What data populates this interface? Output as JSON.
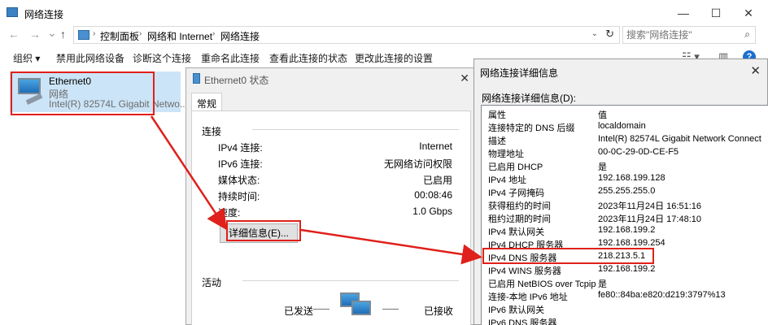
{
  "window": {
    "title": "网络连接",
    "minimize": "—",
    "maximize": "☐",
    "close": "✕"
  },
  "address": {
    "back": "←",
    "forward": "→",
    "recent": "⌄",
    "up": "↑",
    "crumbs": [
      "控制面板",
      "网络和 Internet",
      "网络连接"
    ],
    "separator": "›",
    "refresh": "↻",
    "search_placeholder": "搜索\"网络连接\""
  },
  "toolbar": {
    "organize": "组织 ▾",
    "items": [
      "禁用此网络设备",
      "诊断这个连接",
      "重命名此连接",
      "查看此连接的状态",
      "更改此连接的设置"
    ],
    "view_icon": "☷ ▾",
    "pane_icon": "▥",
    "help": "?"
  },
  "adapter": {
    "name": "Ethernet0",
    "network": "网络",
    "description": "Intel(R) 82574L Gigabit Netwo..."
  },
  "status_dialog": {
    "title": "Ethernet0 状态",
    "close": "✕",
    "tab": "常规",
    "connection_section": "连接",
    "rows": [
      {
        "label": "IPv4 连接:",
        "value": "Internet"
      },
      {
        "label": "IPv6 连接:",
        "value": "无网络访问权限"
      },
      {
        "label": "媒体状态:",
        "value": "已启用"
      },
      {
        "label": "持续时间:",
        "value": "00:08:46"
      },
      {
        "label": "速度:",
        "value": "1.0 Gbps"
      }
    ],
    "details_button": "详细信息(E)...",
    "activity_section": "活动",
    "sent": "已发送",
    "received": "已接收"
  },
  "details_dialog": {
    "title": "网络连接详细信息",
    "close": "✕",
    "list_label": "网络连接详细信息(D):",
    "header": {
      "property": "属性",
      "value": "值"
    },
    "rows": [
      {
        "property": "连接特定的 DNS 后缀",
        "value": "localdomain"
      },
      {
        "property": "描述",
        "value": "Intel(R) 82574L Gigabit Network Connect"
      },
      {
        "property": "物理地址",
        "value": "00-0C-29-0D-CE-F5"
      },
      {
        "property": "已启用 DHCP",
        "value": "是"
      },
      {
        "property": "IPv4 地址",
        "value": "192.168.199.128"
      },
      {
        "property": "IPv4 子网掩码",
        "value": "255.255.255.0"
      },
      {
        "property": "获得租约的时间",
        "value": "2023年11月24日 16:51:16"
      },
      {
        "property": "租约过期的时间",
        "value": "2023年11月24日 17:48:10"
      },
      {
        "property": "IPv4 默认网关",
        "value": "192.168.199.2"
      },
      {
        "property": "IPv4 DHCP 服务器",
        "value": "192.168.199.254"
      },
      {
        "property": "IPv4 DNS 服务器",
        "value": "218.213.5.1"
      },
      {
        "property": "IPv4 WINS 服务器",
        "value": "192.168.199.2"
      },
      {
        "property": "已启用 NetBIOS over Tcpip",
        "value": "是"
      },
      {
        "property": "连接-本地 IPv6 地址",
        "value": "fe80::84ba:e820:d219:3797%13"
      },
      {
        "property": "IPv6 默认网关",
        "value": ""
      },
      {
        "property": "IPv6 DNS 服务器",
        "value": ""
      }
    ]
  },
  "colors": {
    "highlight_red": "#e0201a",
    "selection_blue": "#cce4f7"
  }
}
